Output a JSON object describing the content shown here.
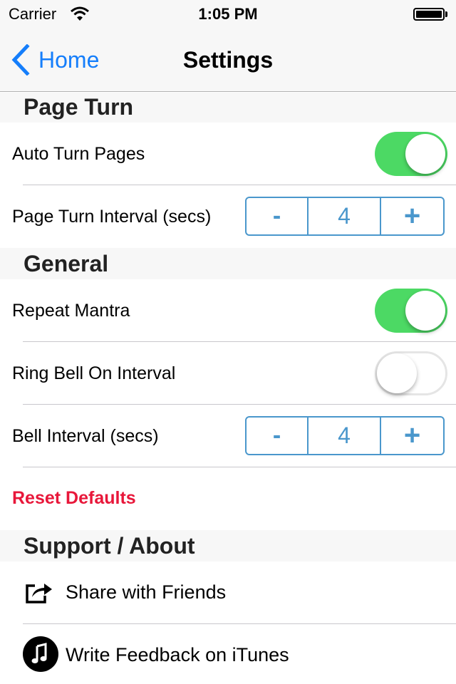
{
  "status_bar": {
    "carrier": "Carrier",
    "time": "1:05 PM",
    "wifi_icon": "wifi-icon",
    "battery_icon": "battery-icon"
  },
  "nav": {
    "back_label": "Home",
    "back_icon": "chevron-left-icon",
    "title": "Settings"
  },
  "colors": {
    "accent": "#157efb",
    "toggle_on": "#4cd964",
    "stepper": "#4a97cc",
    "destructive": "#e8173a"
  },
  "sections": {
    "page_turn": {
      "header": "Page Turn",
      "auto_turn": {
        "label": "Auto Turn Pages",
        "on": true
      },
      "interval": {
        "label": "Page Turn Interval (secs)",
        "minus": "-",
        "value": "4",
        "plus": "+"
      }
    },
    "general": {
      "header": "General",
      "repeat_mantra": {
        "label": "Repeat Mantra",
        "on": true
      },
      "ring_bell": {
        "label": "Ring Bell On Interval",
        "on": false
      },
      "bell_interval": {
        "label": "Bell Interval (secs)",
        "minus": "-",
        "value": "4",
        "plus": "+"
      },
      "reset": "Reset Defaults"
    },
    "support": {
      "header": "Support / About",
      "items": [
        {
          "label": "Share with Friends",
          "icon": "share-icon"
        },
        {
          "label": "Write Feedback on iTunes",
          "icon": "itunes-music-note-icon"
        }
      ]
    }
  }
}
